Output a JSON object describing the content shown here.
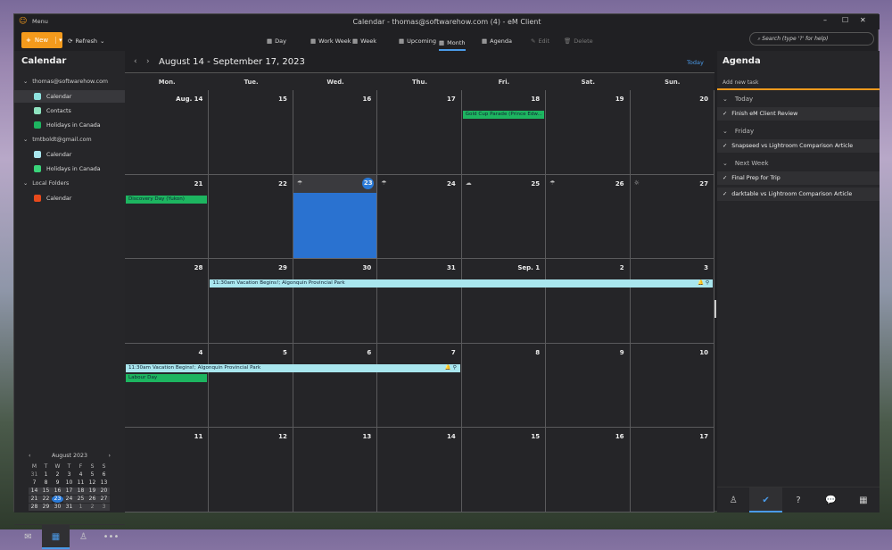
{
  "window": {
    "title": "Calendar - thomas@softwarehow.com (4) - eM Client",
    "menu": "Menu"
  },
  "toolbar": {
    "new": "New",
    "refresh": "Refresh",
    "views": [
      {
        "icon": "day-icon",
        "label": "Day"
      },
      {
        "icon": "work-week-icon",
        "label": "Work Week"
      },
      {
        "icon": "week-icon",
        "label": "Week"
      },
      {
        "icon": "upcoming-icon",
        "label": "Upcoming"
      },
      {
        "icon": "month-icon",
        "label": "Month",
        "active": true
      },
      {
        "icon": "agenda-icon",
        "label": "Agenda"
      }
    ],
    "edit": "Edit",
    "delete": "Delete",
    "search_placeholder": "Search (type '?' for help)"
  },
  "sidebar": {
    "title": "Calendar",
    "accounts": [
      {
        "name": "thomas@softwarehow.com",
        "items": [
          {
            "label": "Calendar",
            "color": "#8fe3e0",
            "selected": true
          },
          {
            "label": "Contacts",
            "color": "#8fe3c0"
          },
          {
            "label": "Holidays in Canada",
            "color": "#1db560"
          }
        ]
      },
      {
        "name": "tmtboldt@gmail.com",
        "items": [
          {
            "label": "Calendar",
            "color": "#a9e6ee"
          },
          {
            "label": "Holidays in Canada",
            "color": "#3ad47a"
          }
        ]
      },
      {
        "name": "Local Folders",
        "items": [
          {
            "label": "Calendar",
            "color": "#e84a1c"
          }
        ]
      }
    ],
    "mini": {
      "month": "August 2023",
      "dow": [
        "M",
        "T",
        "W",
        "T",
        "F",
        "S",
        "S"
      ],
      "days": [
        "31",
        "1",
        "2",
        "3",
        "4",
        "5",
        "6",
        "7",
        "8",
        "9",
        "10",
        "11",
        "12",
        "13",
        "14",
        "15",
        "16",
        "17",
        "18",
        "19",
        "20",
        "21",
        "22",
        "23",
        "24",
        "25",
        "26",
        "27",
        "28",
        "29",
        "30",
        "31",
        "1",
        "2",
        "3"
      ],
      "today": "23"
    }
  },
  "main": {
    "range": "August 14 - September 17, 2023",
    "today": "Today",
    "weekdays": [
      "Mon.",
      "Tue.",
      "Wed.",
      "Thu.",
      "Fri.",
      "Sat.",
      "Sun."
    ],
    "days": [
      "Aug. 14",
      "15",
      "16",
      "17",
      "18",
      "19",
      "20",
      "21",
      "22",
      "23",
      "24",
      "25",
      "26",
      "27",
      "28",
      "29",
      "30",
      "31",
      "Sep. 1",
      "2",
      "3",
      "4",
      "5",
      "6",
      "7",
      "8",
      "9",
      "10",
      "11",
      "12",
      "13",
      "14",
      "15",
      "16",
      "17"
    ],
    "today_label": "23",
    "weather": {
      "9": "rain-icon",
      "10": "rain-icon",
      "11": "cloudy-icon",
      "12": "rain-icon",
      "13": "sunny-icon"
    },
    "events": [
      {
        "title": "Gold Cup Parade (Prince Edw...",
        "row": 0,
        "start": 4,
        "end": 4,
        "color": "#1db560",
        "slot": 0
      },
      {
        "title": "Discovery Day (Yukon)",
        "row": 1,
        "start": 0,
        "end": 0,
        "color": "#1db560",
        "slot": 0
      },
      {
        "time": "11:30am",
        "title": "Vacation Begins!; Algonquin Provincial Park",
        "row": 2,
        "start": 1,
        "end": 6,
        "color": "#a9e6ee",
        "slot": 0,
        "icons": "🔔 ⚲"
      },
      {
        "time": "11:30am",
        "title": "Vacation Begins!; Algonquin Provincial Park",
        "row": 3,
        "start": 0,
        "end": 3,
        "color": "#a9e6ee",
        "slot": 0,
        "icons": "🔔 ⚲"
      },
      {
        "title": "Labour Day",
        "row": 3,
        "start": 0,
        "end": 0,
        "color": "#1db560",
        "slot": 1
      }
    ]
  },
  "agenda": {
    "title": "Agenda",
    "add_placeholder": "Add new task",
    "groups": [
      {
        "label": "Today",
        "tasks": [
          "Finish eM Client Review"
        ]
      },
      {
        "label": "Friday",
        "tasks": [
          "Snapseed vs Lightroom Comparison Article"
        ]
      },
      {
        "label": "Next Week",
        "tasks": [
          "Final Prep for Trip",
          "darktable vs Lightroom Comparison Article"
        ]
      }
    ]
  }
}
